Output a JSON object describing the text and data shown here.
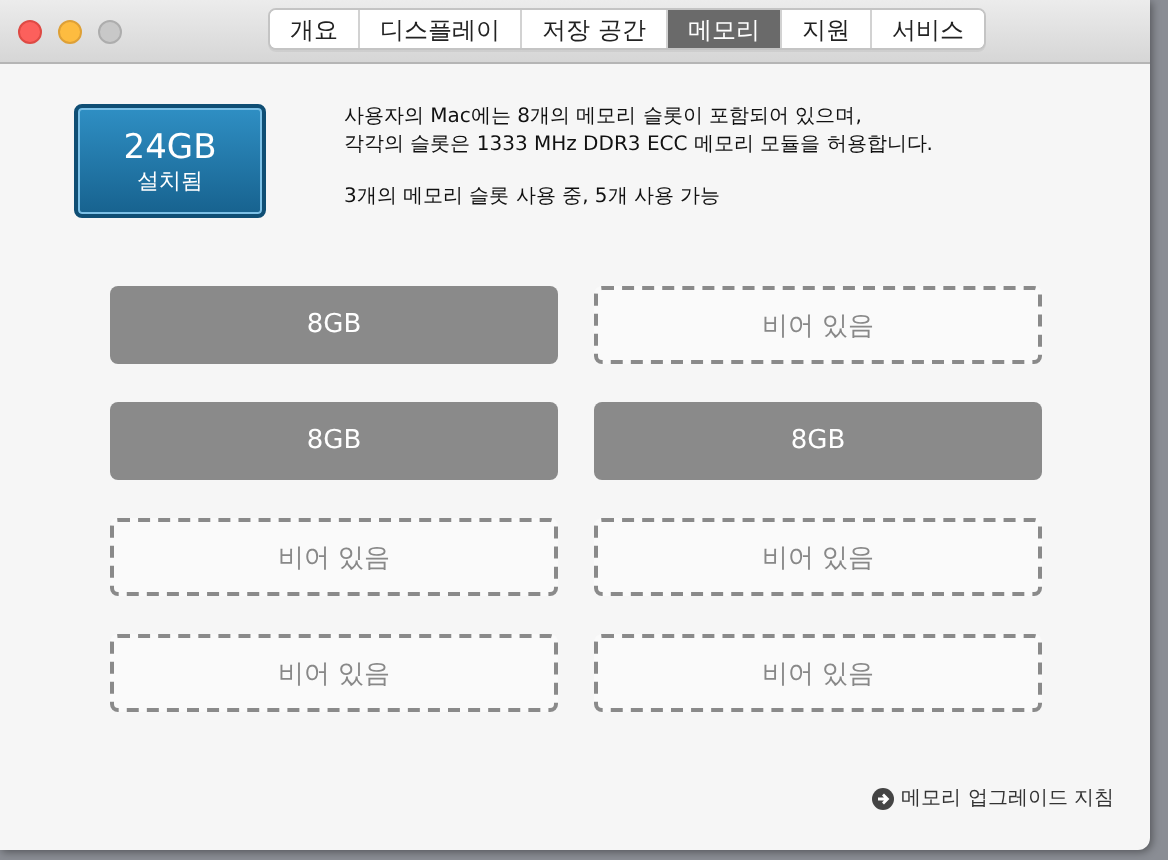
{
  "tabs": [
    {
      "label": "개요",
      "selected": false
    },
    {
      "label": "디스플레이",
      "selected": false
    },
    {
      "label": "저장 공간",
      "selected": false
    },
    {
      "label": "메모리",
      "selected": true
    },
    {
      "label": "지원",
      "selected": false
    },
    {
      "label": "서비스",
      "selected": false
    }
  ],
  "memory_badge": {
    "size": "24GB",
    "caption": "설치됨"
  },
  "description": [
    "사용자의 Mac에는 8개의 메모리 슬롯이 포함되어 있으며,\n각각의 슬롯은 1333 MHz DDR3 ECC 메모리 모듈을 허용합니다.",
    "3개의 메모리 슬롯 사용 중, 5개 사용 가능"
  ],
  "slots": [
    {
      "kind": "filled",
      "label": "8GB"
    },
    {
      "kind": "empty",
      "label": "비어 있음"
    },
    {
      "kind": "filled",
      "label": "8GB"
    },
    {
      "kind": "filled",
      "label": "8GB"
    },
    {
      "kind": "empty",
      "label": "비어 있음"
    },
    {
      "kind": "empty",
      "label": "비어 있음"
    },
    {
      "kind": "empty",
      "label": "비어 있음"
    },
    {
      "kind": "empty",
      "label": "비어 있음"
    }
  ],
  "upgrade_link": "메모리 업그레이드 지침"
}
